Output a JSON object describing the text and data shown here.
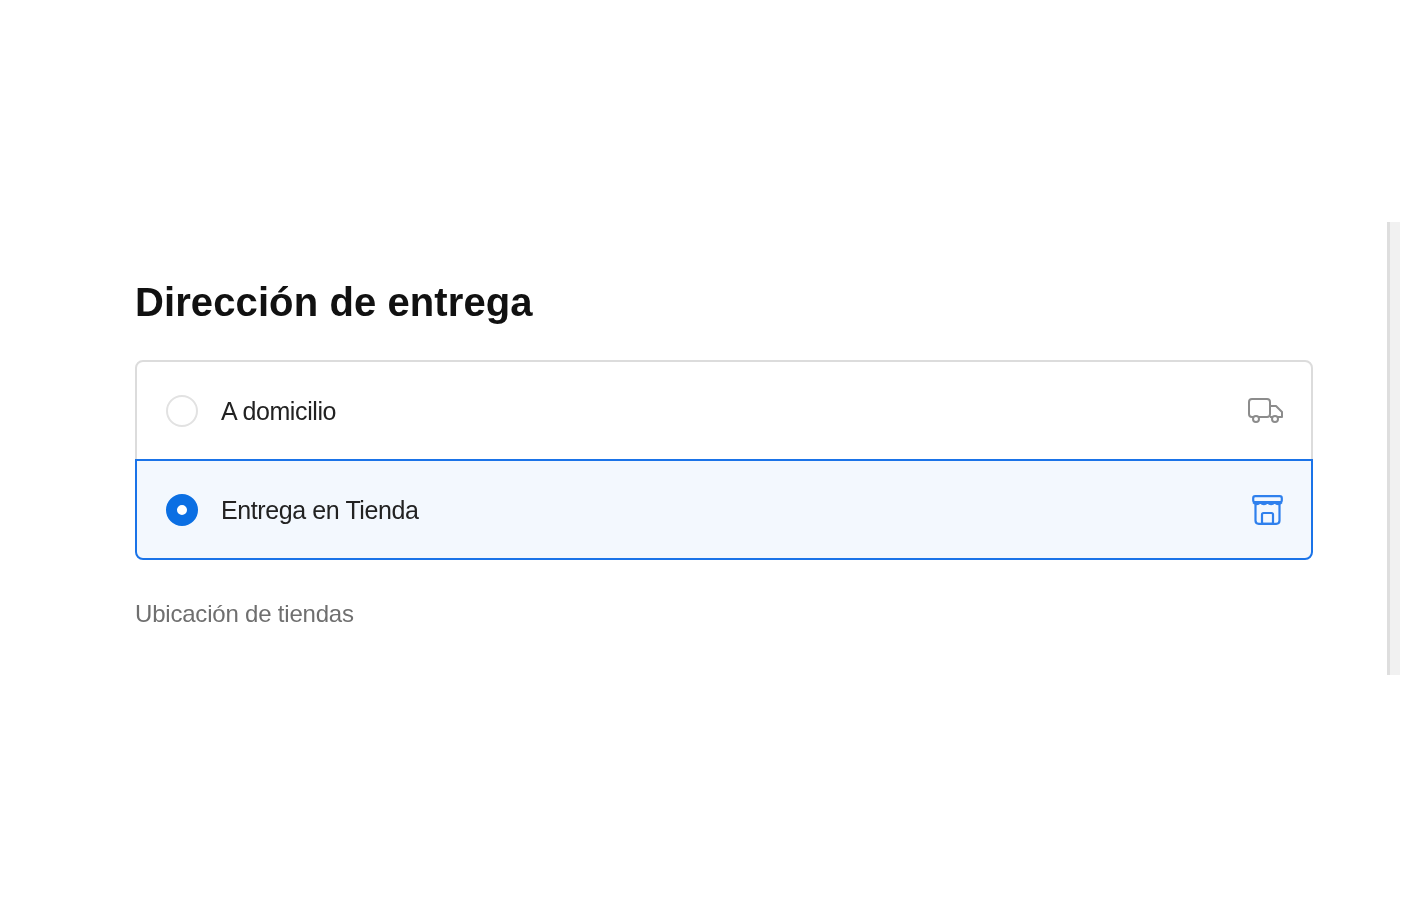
{
  "heading": "Dirección de entrega",
  "delivery_options": [
    {
      "label": "A domicilio",
      "kind": "home",
      "selected": false
    },
    {
      "label": "Entrega en Tienda",
      "kind": "store",
      "selected": true
    }
  ],
  "store_locations": {
    "label": "Ubicación de tiendas"
  }
}
